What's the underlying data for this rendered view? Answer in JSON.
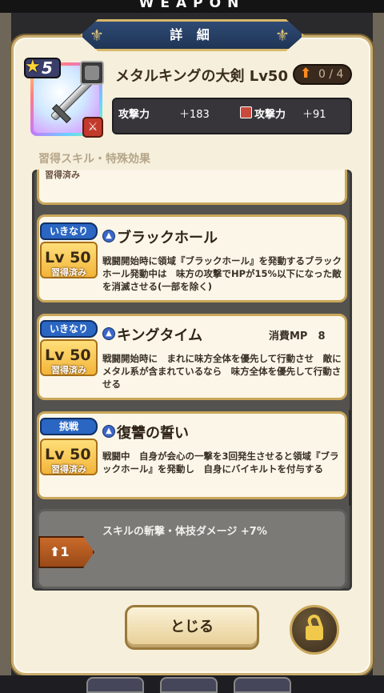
{
  "screen": {
    "top_title": "WEAPON"
  },
  "header": {
    "title": "詳 細"
  },
  "weapon": {
    "rarity": "5",
    "name": "メタルキングの大剣 Lv50",
    "upgrade": "0 / 4",
    "stats": [
      {
        "label": "攻撃力",
        "value": "＋183"
      },
      {
        "label": "攻撃力",
        "value": "＋91"
      }
    ]
  },
  "section_label": "習得スキル・特殊効果",
  "partial_card_text": "習得済み",
  "skills": [
    {
      "trigger": "いきなり",
      "level": "Lv 50",
      "learned": "習得済み",
      "name": "ブラックホール",
      "mp": "",
      "description": "戦闘開始時に領域『ブラックホール』を発動するブラックホール発動中は　味方の攻撃でHPが15%以下になった敵を消滅させる(一部を除く)"
    },
    {
      "trigger": "いきなり",
      "level": "Lv 50",
      "learned": "習得済み",
      "name": "キングタイム",
      "mp": "消費MP　8",
      "description": "戦闘開始時に　まれに味方全体を優先して行動させ　敵にメタル系が含まれているなら　味方全体を優先して行動させる"
    },
    {
      "trigger": "挑戦",
      "level": "Lv 50",
      "learned": "習得済み",
      "name": "復讐の誓い",
      "mp": "",
      "description": "戦闘中　自身が会心の一撃を3回発生させると領域『ブラックホール』を発動し　自身にバイキルトを付与する"
    }
  ],
  "bonus": {
    "text": "スキルの斬撃・体技ダメージ +7%",
    "badge": "1"
  },
  "buttons": {
    "close": "とじる"
  },
  "icons": {
    "star": "star-icon",
    "sword": "sword-icon",
    "lock": "unlock-icon",
    "skill": "skill-orb-icon"
  }
}
